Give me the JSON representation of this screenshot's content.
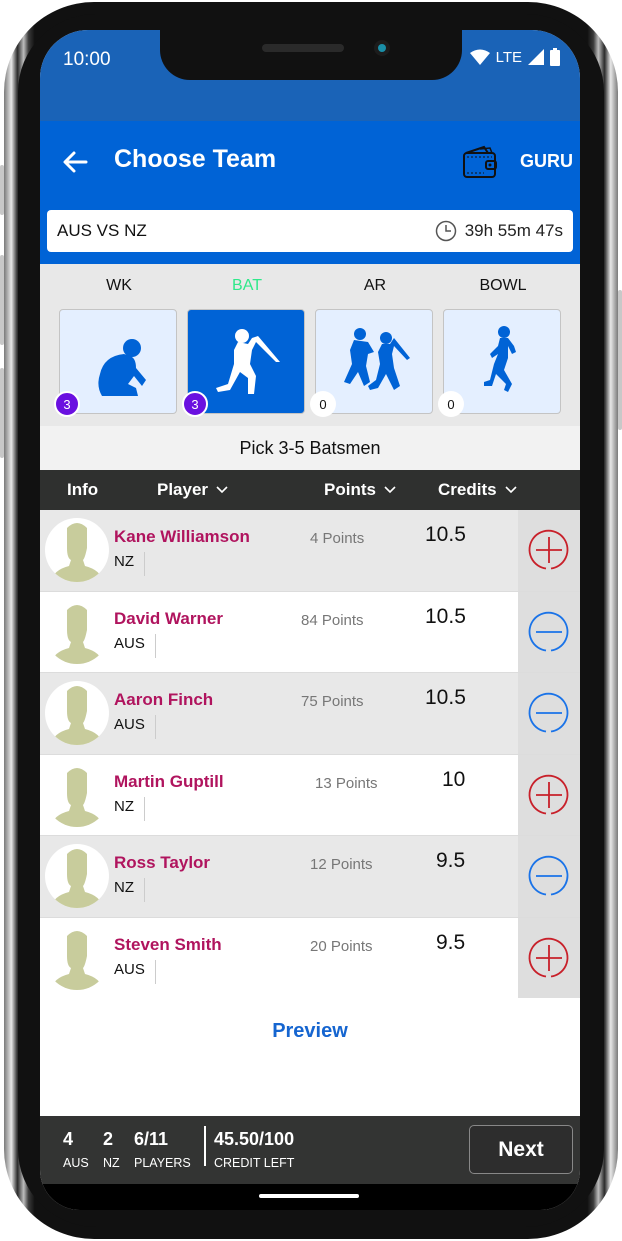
{
  "status_bar": {
    "time": "10:00",
    "network": "LTE",
    "icons": [
      "wifi-icon",
      "signal-icon",
      "battery-icon"
    ]
  },
  "app_bar": {
    "back_icon": "arrow-left-icon",
    "title": "Choose Team",
    "wallet_icon": "wallet-icon",
    "guru_label": "GURU",
    "colors": {
      "primary": "#0063d6",
      "status_bar": "#1a63b7"
    }
  },
  "match": {
    "title": "AUS VS NZ",
    "timer_icon": "clock-icon",
    "countdown": "39h 55m 47s"
  },
  "roles": [
    {
      "label": "WK",
      "count": "3",
      "active": false,
      "icon": "wicketkeeper-icon"
    },
    {
      "label": "BAT",
      "count": "3",
      "active": true,
      "icon": "batsman-icon"
    },
    {
      "label": "AR",
      "count": "0",
      "active": false,
      "icon": "allrounder-icon"
    },
    {
      "label": "BOWL",
      "count": "0",
      "active": false,
      "icon": "bowler-icon"
    }
  ],
  "pick_instruction": "Pick 3-5 Batsmen",
  "table": {
    "headers": {
      "info": "Info",
      "player": "Player",
      "points": "Points",
      "credits": "Credits"
    },
    "rows": [
      {
        "name": "Kane Williamson",
        "team": "NZ",
        "points": "4 Points",
        "credits": "10.5",
        "action": "add",
        "selected": false
      },
      {
        "name": "David Warner",
        "team": "AUS",
        "points": "84 Points",
        "credits": "10.5",
        "action": "remove",
        "selected": true
      },
      {
        "name": "Aaron Finch",
        "team": "AUS",
        "points": "75 Points",
        "credits": "10.5",
        "action": "remove",
        "selected": true
      },
      {
        "name": "Martin Guptill",
        "team": "NZ",
        "points": "13 Points",
        "credits": "10",
        "action": "add",
        "selected": false
      },
      {
        "name": "Ross Taylor",
        "team": "NZ",
        "points": "12 Points",
        "credits": "9.5",
        "action": "remove",
        "selected": true
      },
      {
        "name": "Steven Smith",
        "team": "AUS",
        "points": "20 Points",
        "credits": "9.5",
        "action": "add",
        "selected": false
      }
    ]
  },
  "preview_label": "Preview",
  "footer": {
    "aus_count": "4",
    "aus_label": "AUS",
    "nz_count": "2",
    "nz_label": "NZ",
    "players_value": "6/11",
    "players_label": "PLAYERS",
    "credit_value": "45.50/100",
    "credit_label": "CREDIT LEFT",
    "next_label": "Next"
  },
  "colors": {
    "add": "#c8202a",
    "remove": "#1a73e8",
    "player_name": "#b0145e",
    "active_role_label": "#2ee88a",
    "role_count_badge": "#6a10e0"
  }
}
